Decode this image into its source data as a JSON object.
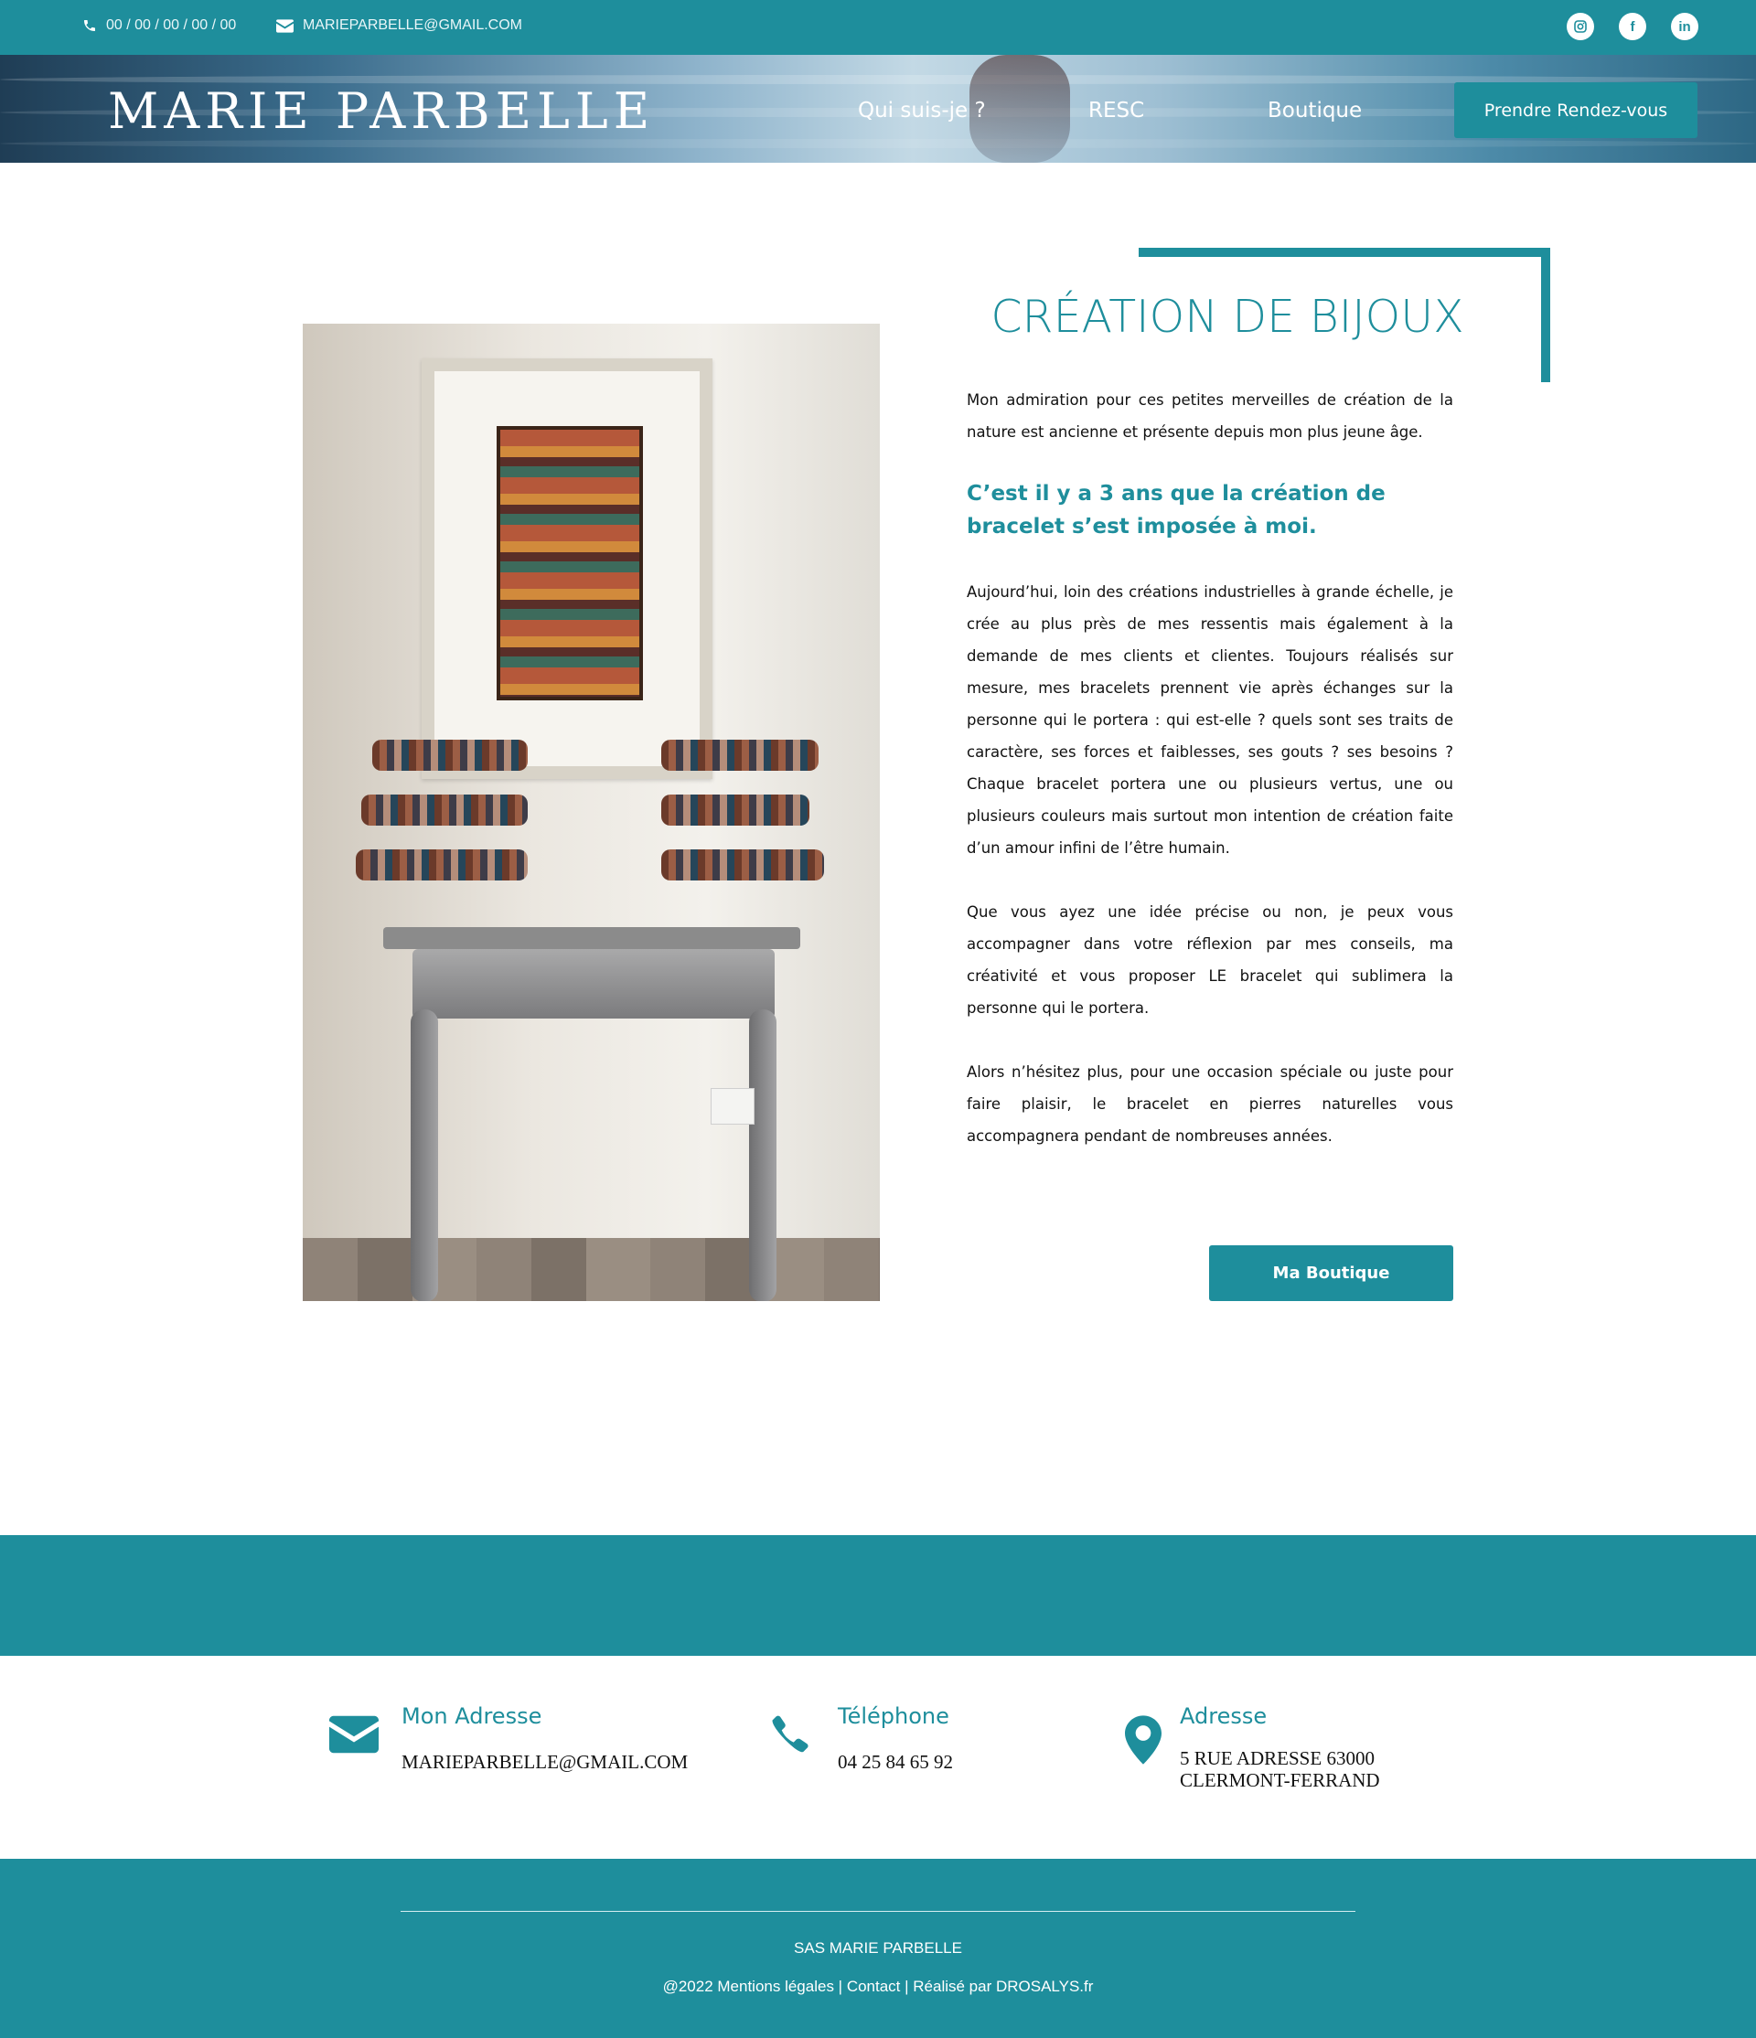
{
  "topbar": {
    "phone": "00 / 00 / 00 / 00 / 00",
    "email": "MARIEPARBELLE@GMAIL.COM",
    "social_icons": [
      "instagram-icon",
      "facebook-icon",
      "linkedin-icon"
    ]
  },
  "header": {
    "brand": "MARIE PARBELLE",
    "nav": [
      "Qui suis-je ?",
      "RESC",
      "Boutique"
    ],
    "cta": "Prendre Rendez-vous"
  },
  "main": {
    "title": "CRÉATION DE BIJOUX",
    "intro": "Mon admiration pour ces petites merveilles de création de la nature est ancienne et présente depuis mon plus jeune âge.",
    "highlight": "C’est il y a 3 ans que la création de bracelet s’est imposée à moi.",
    "paragraph2": "Aujourd’hui, loin des créations industrielles à grande échelle, je crée au plus près de mes ressentis mais également à la demande de mes clients et clientes. Toujours réalisés sur mesure, mes bracelets prennent vie après échanges sur la personne qui le portera : qui est-elle ? quels sont ses traits de caractère, ses forces et faiblesses, ses gouts ? ses besoins ? Chaque bracelet portera une ou plusieurs vertus, une ou plusieurs couleurs mais surtout mon intention de création faite d’un amour infini de l’être humain.",
    "paragraph3": "Que vous ayez une idée précise ou non, je peux vous accompagner dans votre réflexion par mes conseils, ma créativité et vous proposer LE bracelet qui sublimera la personne qui le portera.",
    "paragraph4": "Alors n’hésitez plus, pour une occasion spéciale ou juste pour faire plaisir, le bracelet en pierres naturelles vous accompagnera pendant de nombreuses années.",
    "button": "Ma Boutique"
  },
  "contacts": [
    {
      "icon": "envelope-icon",
      "title": "Mon Adresse",
      "value": "MARIEPARBELLE@GMAIL.COM"
    },
    {
      "icon": "phone-icon",
      "title": "Téléphone",
      "value": "04 25 84 65 92"
    },
    {
      "icon": "map-pin-icon",
      "title": "Adresse",
      "value_line1": "5 RUE ADRESSE 63000",
      "value_line2": "CLERMONT-FERRAND"
    }
  ],
  "footer": {
    "company": "SAS MARIE PARBELLE",
    "links": "@2022  Mentions légales | Contact | Réalisé par DROSALYS.fr"
  },
  "colors": {
    "accent": "#1e8e9c",
    "text": "#111111",
    "background": "#ffffff"
  }
}
